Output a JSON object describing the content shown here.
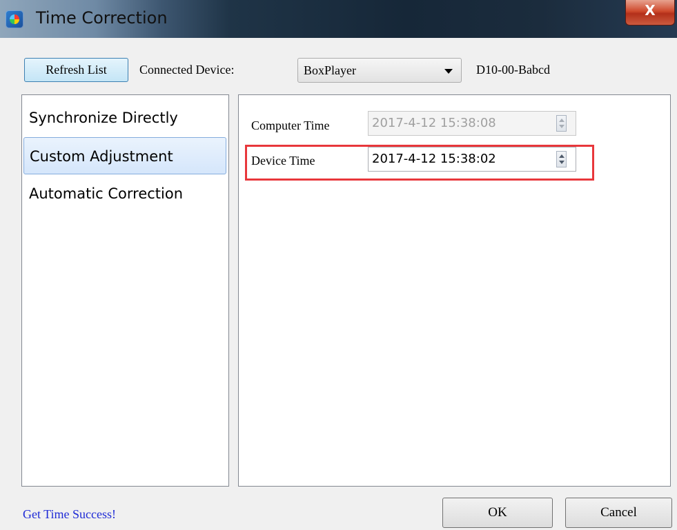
{
  "window": {
    "title": "Time Correction",
    "close_label": "X"
  },
  "toolbar": {
    "refresh_label": "Refresh List",
    "connected_label": "Connected Device:",
    "device_selected": "BoxPlayer",
    "device_id": "D10-00-Babcd"
  },
  "modes": [
    {
      "label": "Synchronize Directly",
      "selected": false
    },
    {
      "label": "Custom Adjustment",
      "selected": true
    },
    {
      "label": "Automatic Correction",
      "selected": false
    }
  ],
  "fields": {
    "computer_time_label": "Computer Time",
    "computer_time_value": "2017-4-12 15:38:08",
    "device_time_label": "Device Time",
    "device_time_value": "2017-4-12 15:38:02"
  },
  "footer": {
    "status": "Get Time Success!",
    "ok_label": "OK",
    "cancel_label": "Cancel"
  },
  "colors": {
    "status_text": "#1f2bd6",
    "highlight_box": "#e8373b",
    "selected_item": "#d5e6fb"
  }
}
